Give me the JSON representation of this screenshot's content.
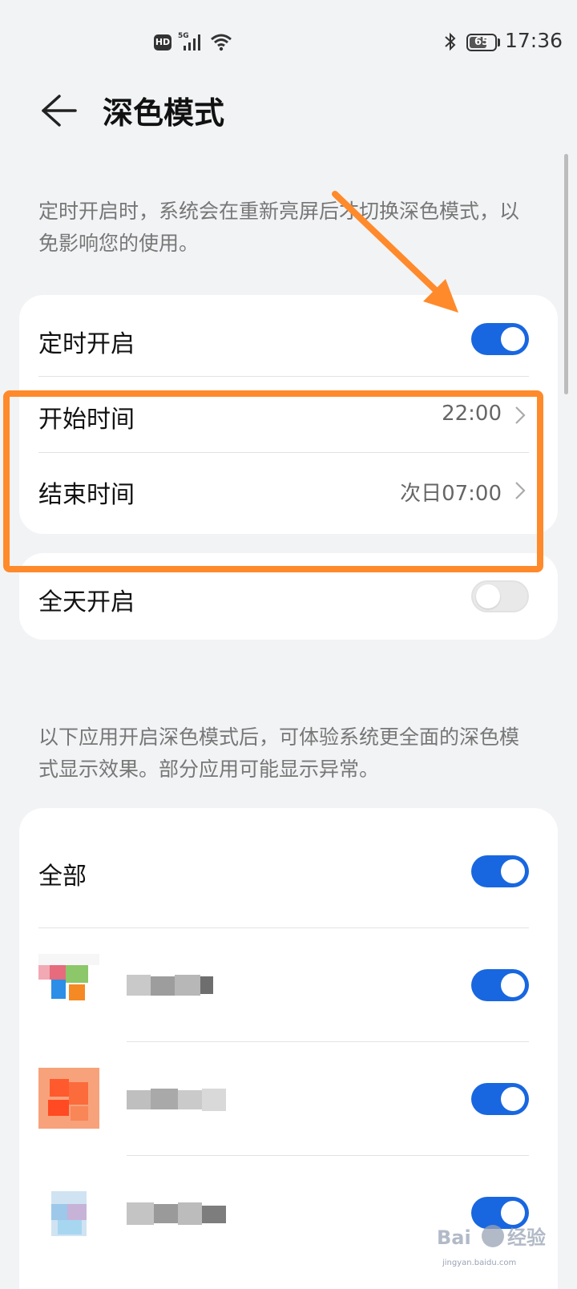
{
  "status_bar": {
    "time": "17:36",
    "battery": "65",
    "hd": "HD",
    "network": "5G"
  },
  "header": {
    "title": "深色模式",
    "back_icon": "back-arrow-icon"
  },
  "schedule_note": "定时开启时，系统会在重新亮屏后才切换深色模式，以免影响您的使用。",
  "schedule": {
    "toggle_label": "定时开启",
    "toggle_on": true,
    "start_label": "开始时间",
    "start_value": "22:00",
    "end_label": "结束时间",
    "end_value": "次日07:00"
  },
  "all_day": {
    "label": "全天开启",
    "on": false
  },
  "apps_note": "以下应用开启深色模式后，可体验系统更全面的深色模式显示效果。部分应用可能显示异常。",
  "apps": {
    "all_label": "全部",
    "all_on": true,
    "items": [
      {
        "on": true
      },
      {
        "on": true
      },
      {
        "on": true
      }
    ]
  },
  "colors": {
    "accent": "#1866e0",
    "annotation": "#ff8a2b",
    "background": "#f1f3f5"
  },
  "watermark": {
    "brand": "Baidu",
    "sub": "jingyan.baidu.com",
    "extra": "经验"
  }
}
